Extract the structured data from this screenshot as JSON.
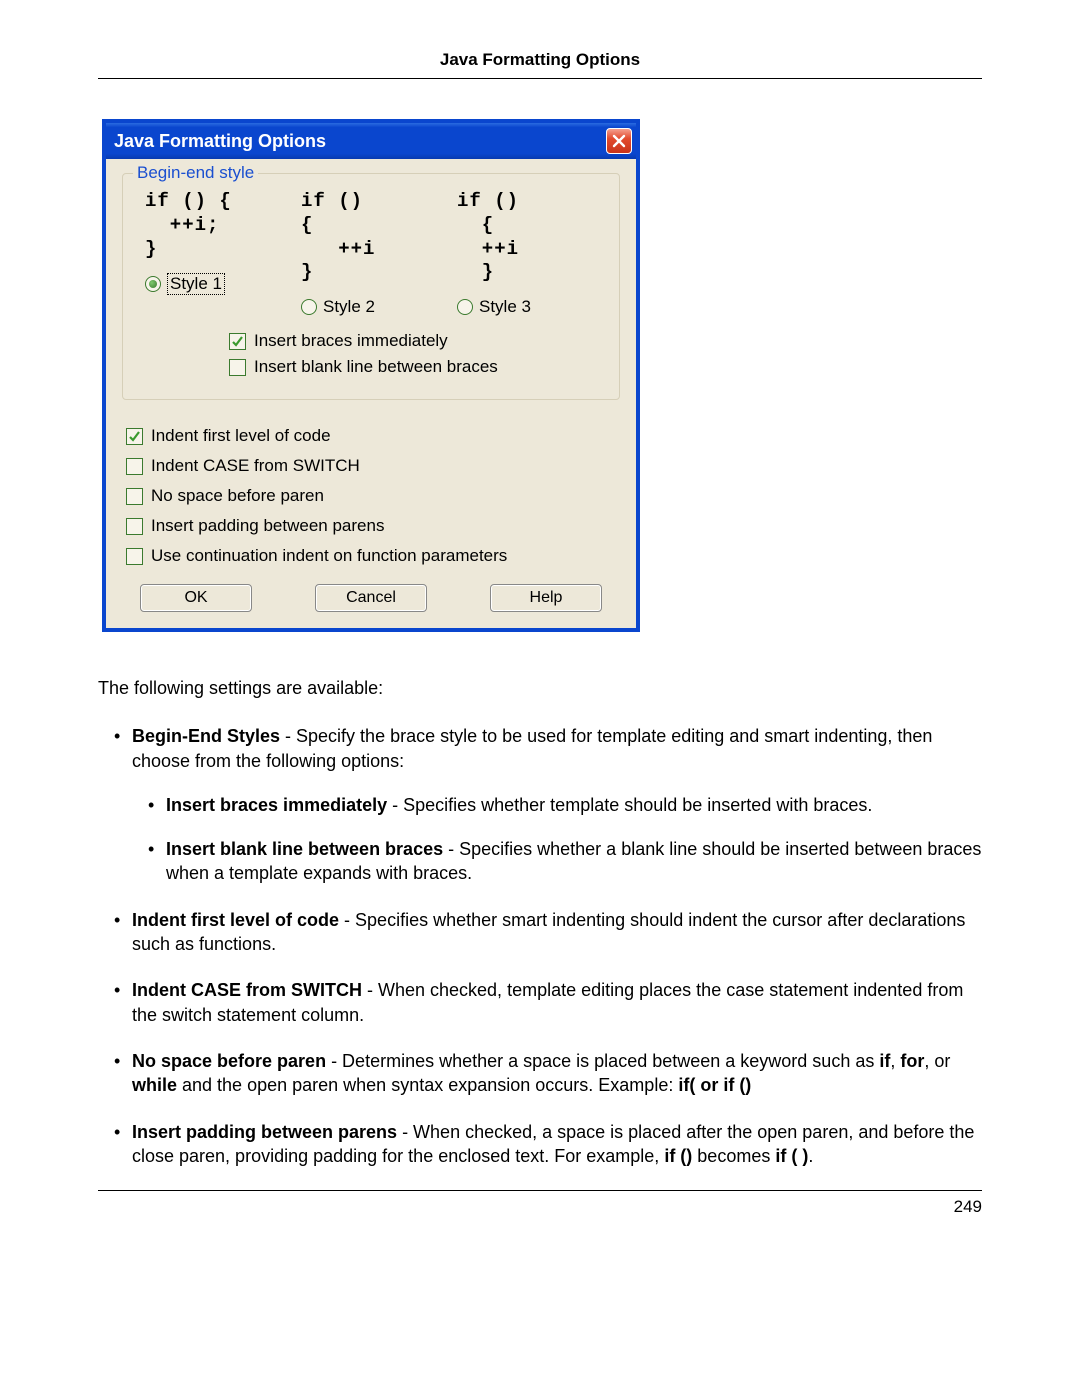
{
  "header": {
    "title": "Java Formatting Options"
  },
  "dialog": {
    "title": "Java Formatting Options",
    "fieldset_legend": "Begin-end style",
    "styles": {
      "s1": {
        "code": "if () {\n  ++i;\n}",
        "label": "Style 1",
        "selected": true,
        "focused": true
      },
      "s2": {
        "code": "if ()\n{\n   ++i\n}",
        "label": "Style 2",
        "selected": false,
        "focused": false
      },
      "s3": {
        "code": "if ()\n  {\n  ++i\n  }",
        "label": "Style 3",
        "selected": false,
        "focused": false
      }
    },
    "inner_checks": {
      "insert_braces": {
        "label": "Insert braces immediately",
        "checked": true
      },
      "blank_line": {
        "label": "Insert blank line between braces",
        "checked": false
      }
    },
    "outer_checks": {
      "indent_first": {
        "label": "Indent first level of code",
        "checked": true
      },
      "indent_case": {
        "label": "Indent CASE from SWITCH",
        "checked": false
      },
      "no_space": {
        "label": "No space before paren",
        "checked": false
      },
      "pad_parens": {
        "label": "Insert padding between parens",
        "checked": false
      },
      "continuation": {
        "label": "Use continuation indent on function parameters",
        "checked": false
      }
    },
    "buttons": {
      "ok": "OK",
      "cancel": "Cancel",
      "help": "Help"
    }
  },
  "body": {
    "intro": "The following settings are available:",
    "items": {
      "begin_end": {
        "term": "Begin-End Styles",
        "rest": " - Specify the brace style to be used for template editing and smart indenting, then choose from the following options:"
      },
      "insert_braces": {
        "term": "Insert braces immediately",
        "rest": " - Specifies whether template should be inserted with braces."
      },
      "blank_line": {
        "term": "Insert blank line between braces",
        "rest": " - Specifies whether a blank line should be inserted between braces when a template expands with braces."
      },
      "indent_first": {
        "term": "Indent first level of code",
        "rest": " - Specifies whether smart indenting should indent the cursor after declarations such as functions."
      },
      "indent_case": {
        "term": "Indent CASE from SWITCH",
        "rest": " - When checked, template editing places the case statement indented from the switch statement column."
      },
      "no_space": {
        "term": "No space before paren",
        "rest_a": " - Determines whether a space is placed between a keyword such as ",
        "kw_if": "if",
        "comma1": ", ",
        "kw_for": "for",
        "or": ", or ",
        "kw_while": "while",
        "rest_b": " and the open paren when syntax expansion occurs. Example: ",
        "example": "if( or if ()"
      },
      "pad_parens": {
        "term": "Insert padding between parens",
        "rest_a": " - When checked, a space is placed after the open paren, and before the close paren, providing padding for the enclosed text. For example, ",
        "ex1": "if ()",
        "mid": " becomes ",
        "ex2": "if ( )",
        "dot": "."
      }
    }
  },
  "footer": {
    "page_number": "249"
  }
}
